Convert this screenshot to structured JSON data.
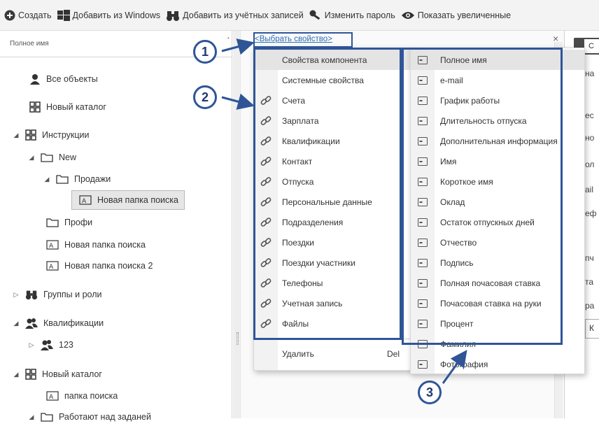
{
  "toolbar": {
    "create": "Создать",
    "add_from_windows": "Добавить из Windows",
    "add_from_accounts": "Добавить из учётных записей",
    "change_password": "Изменить пароль",
    "show_extended": "Показать увеличенные"
  },
  "left_panel": {
    "header": "Полное имя",
    "tree": {
      "all_objects": "Все объекты",
      "new_catalog_1": "Новый каталог",
      "instructions": "Инструкции",
      "new": "New",
      "sales": "Продажи",
      "new_search_folder_selected": "Новая папка поиска",
      "profi": "Профи",
      "new_search_folder": "Новая папка поиска",
      "new_search_folder_2": "Новая папка поиска 2",
      "groups_roles": "Группы и роли",
      "qualifications": "Квалификации",
      "q_123": "123",
      "new_catalog_2": "Новый каталог",
      "search_folder": "папка поиска",
      "in_progress": "Работают над заданей"
    }
  },
  "property_picker": {
    "select_link": "<Выбрать свойство>",
    "close": "×"
  },
  "menu_categories": {
    "items": [
      "Свойства компонента",
      "Системные свойства",
      "Счета",
      "Зарплата",
      "Квалификации",
      "Контакт",
      "Отпуска",
      "Персональные данные",
      "Подразделения",
      "Поездки",
      "Поездки участники",
      "Телефоны",
      "Учетная запись",
      "Файлы"
    ],
    "delete_label": "Удалить",
    "delete_key": "Del"
  },
  "menu_properties": {
    "items": [
      "Полное имя",
      "e-mail",
      "График работы",
      "Длительность отпуска",
      "Дополнительная информация",
      "Имя",
      "Короткое имя",
      "Оклад",
      "Остаток отпускных дней",
      "Отчество",
      "Подпись",
      "Полная почасовая ставка",
      "Почасовая ставка на руки",
      "Процент",
      "Фамилия",
      "Фотография"
    ]
  },
  "right_panel": {
    "tab": "С",
    "lines": [
      "на",
      "ес",
      "но",
      "ол",
      "аil",
      "еф",
      "пч",
      "та",
      "ра"
    ],
    "input": "К"
  },
  "callouts": {
    "one": "1",
    "two": "2",
    "three": "3"
  },
  "colors": {
    "annotation": "#2f5597",
    "link": "#2a6fb5",
    "menu_highlight": "#e4e4e4"
  }
}
